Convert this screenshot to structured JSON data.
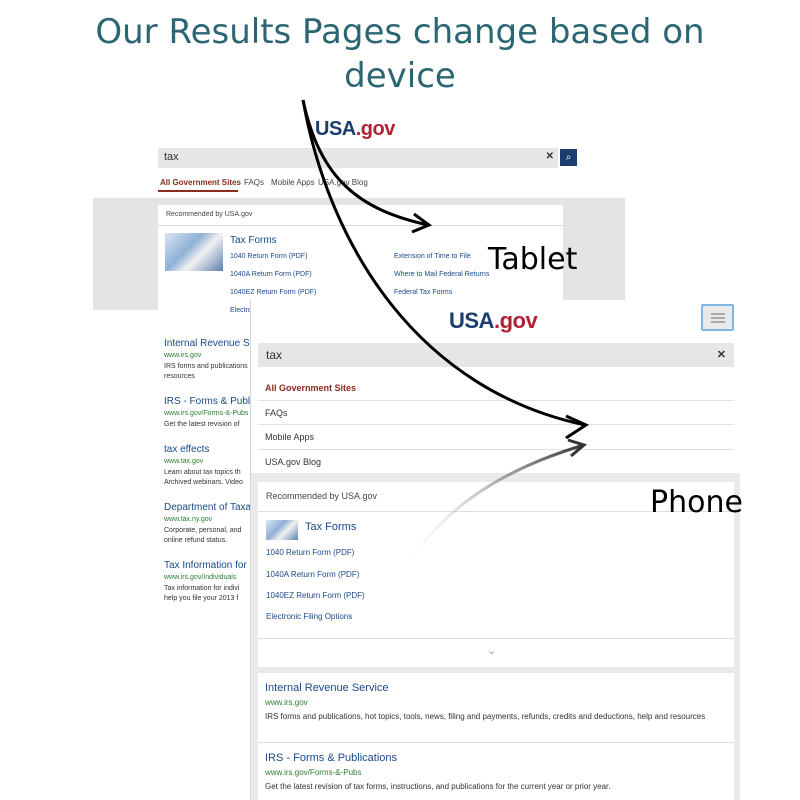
{
  "slide": {
    "title": "Our Results Pages change based on device",
    "label_tablet": "Tablet",
    "label_phone": "Phone"
  },
  "colors": {
    "title": "#2b6673",
    "link": "#1a4a8a",
    "url": "#2e7d32",
    "active_tab": "#8a2c1e",
    "search_button": "#1a3d6e"
  },
  "tablet": {
    "logo": {
      "part1": "USA",
      "part2": ".gov"
    },
    "search": {
      "value": "tax",
      "clear_icon": "times-icon",
      "submit_icon": "search-icon"
    },
    "tabs": [
      "All Government Sites",
      "FAQs",
      "Mobile Apps",
      "USA.gov Blog"
    ],
    "recommended_label": "Recommended by USA.gov",
    "featured_title": "Tax Forms",
    "links_left": [
      "1040 Return Form (PDF)",
      "1040A Return Form (PDF)",
      "1040EZ Return Form (PDF)",
      "Electronic Filing Options"
    ],
    "links_right": [
      "Extension of Time to File",
      "Where to Mail Federal Returns",
      "Federal Tax Forms"
    ],
    "results": [
      {
        "title": "Internal Revenue Service",
        "url": "www.irs.gov",
        "desc1": "IRS forms and publications",
        "desc2": "resources"
      },
      {
        "title": "IRS - Forms & Publications",
        "url": "www.irs.gov/Forms-&-Pubs",
        "desc1": "Get the latest revision of",
        "desc2": ""
      },
      {
        "title": "tax effects",
        "url": "www.tax.gov",
        "desc1": "Learn about tax topics th",
        "desc2": "Archived webinars. Video"
      },
      {
        "title": "Department of Taxation",
        "url": "www.tax.ny.gov",
        "desc1": "Corporate, personal, and",
        "desc2": "online refund status."
      },
      {
        "title": "Tax Information for Individuals",
        "url": "www.irs.gov/Individuals",
        "desc1": "Tax information for indivi",
        "desc2": "help you file your 2013 f"
      }
    ]
  },
  "phone": {
    "logo": {
      "part1": "USA",
      "part2": ".gov"
    },
    "menu_icon": "hamburger-icon",
    "search": {
      "value": "tax",
      "clear_icon": "times-icon"
    },
    "nav": [
      "All Government Sites",
      "FAQs",
      "Mobile Apps",
      "USA.gov Blog"
    ],
    "recommended_label": "Recommended by USA.gov",
    "featured_title": "Tax Forms",
    "links": [
      "1040 Return Form (PDF)",
      "1040A Return Form (PDF)",
      "1040EZ Return Form (PDF)",
      "Electronic Filing Options"
    ],
    "expand_icon": "chevron-down-icon",
    "results": [
      {
        "title": "Internal Revenue Service",
        "url": "www.irs.gov",
        "desc": "IRS forms and publications, hot topics, tools, news, filing and payments, refunds, credits and deductions, help and resources"
      },
      {
        "title": "IRS - Forms & Publications",
        "url": "www.irs.gov/Forms-&-Pubs",
        "desc": "Get the latest revision of tax forms, instructions, and publications for the current year or prior year."
      }
    ]
  }
}
